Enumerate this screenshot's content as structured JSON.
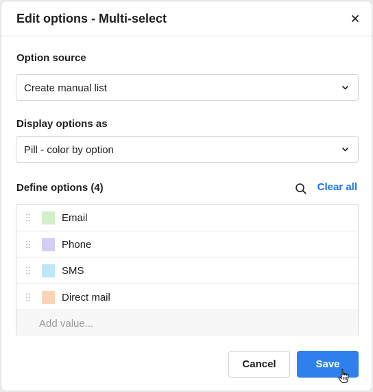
{
  "dialog": {
    "title": "Edit options - Multi-select"
  },
  "option_source": {
    "label": "Option source",
    "value": "Create manual list"
  },
  "display_as": {
    "label": "Display options as",
    "value": "Pill - color by option"
  },
  "define_options": {
    "label": "Define options (4)",
    "clear_all": "Clear all",
    "items": [
      {
        "label": "Email",
        "color": "#d3f0c9"
      },
      {
        "label": "Phone",
        "color": "#d6cdf5"
      },
      {
        "label": "SMS",
        "color": "#bfe6f7"
      },
      {
        "label": "Direct mail",
        "color": "#f9d4b8"
      }
    ],
    "add_placeholder": "Add value..."
  },
  "footer": {
    "cancel_label": "Cancel",
    "save_label": "Save"
  },
  "colors": {
    "accent": "#2f80ed",
    "link": "#1a73e8"
  }
}
